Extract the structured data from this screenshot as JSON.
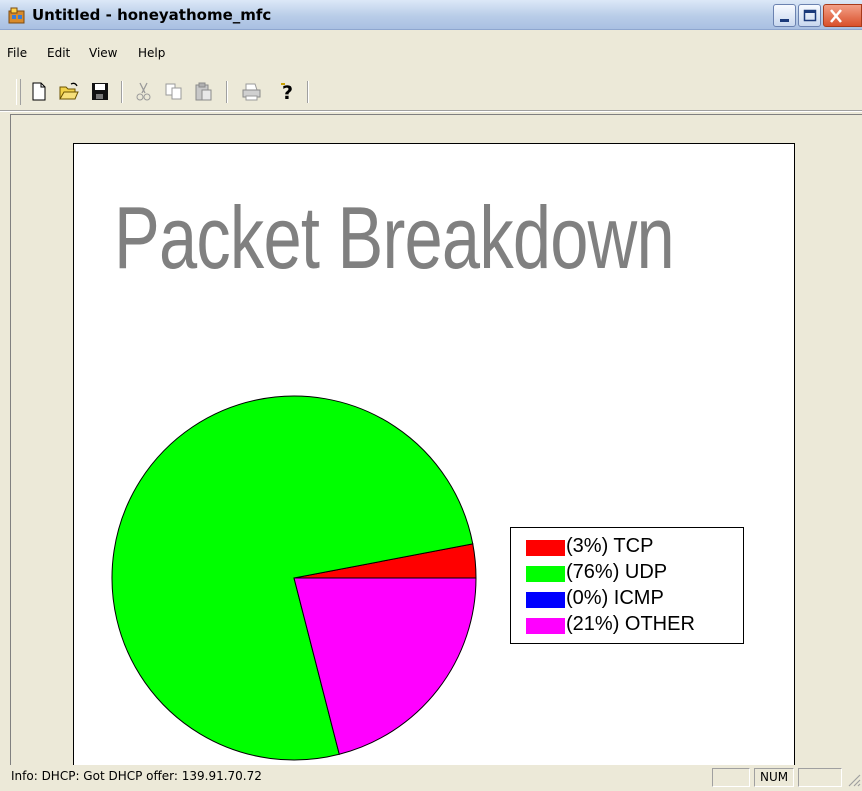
{
  "window": {
    "title": "Untitled - honeyathome_mfc"
  },
  "menu": {
    "items": [
      "File",
      "Edit",
      "View",
      "Help"
    ]
  },
  "toolbar": {
    "buttons": [
      "new-icon",
      "open-icon",
      "save-icon",
      "cut-icon",
      "copy-icon",
      "paste-icon",
      "print-icon",
      "help-icon"
    ]
  },
  "chart_data": {
    "type": "pie",
    "title": "Packet Breakdown",
    "slices": [
      {
        "label": "(3%)  TCP",
        "value": 3,
        "color": "#ff0000"
      },
      {
        "label": "(76%)  UDP",
        "value": 76,
        "color": "#00ff00"
      },
      {
        "label": "(0%)  ICMP",
        "value": 0,
        "color": "#0000ff"
      },
      {
        "label": "(21%)  OTHER",
        "value": 21,
        "color": "#ff00ff"
      }
    ],
    "legend_placement": "right"
  },
  "statusbar": {
    "text": "Info: DHCP: Got DHCP offer: 139.91.70.72",
    "indicator": "NUM"
  }
}
